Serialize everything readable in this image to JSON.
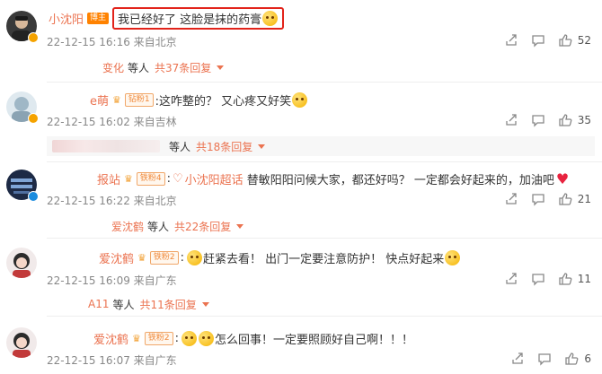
{
  "comments": [
    {
      "user": "小沈阳",
      "tag": "博主",
      "text": "我已经好了 这脸是抹的药膏",
      "time": "22-12-15 16:16 来自北京",
      "likes": "52",
      "replies": {
        "name": "变化",
        "others": "等人",
        "total": "共37条回复"
      }
    },
    {
      "user": "e萌",
      "tag": "钻粉1",
      "text": ":这咋整的？ 又心疼又好笑",
      "time": "22-12-15 16:02 来自吉林",
      "likes": "35",
      "replies": {
        "name": "",
        "others": "等人",
        "total": "共18条回复"
      }
    },
    {
      "user": "报站",
      "tag": "铁粉4",
      "mention": "小沈阳超话",
      "text": "替敏阳阳问候大家，都还好吗？ 一定都会好起来的，加油吧",
      "time": "22-12-15 16:22 来自北京",
      "likes": "21",
      "replies": {
        "name": "爱沈鹤",
        "others": "等人",
        "total": "共22条回复"
      }
    },
    {
      "user": "爱沈鹤",
      "tag": "铁粉2",
      "text": "赶紧去看！ 出门一定要注意防护！ 快点好起来",
      "time": "22-12-15 16:09 来自广东",
      "likes": "11",
      "replies": {
        "name": "A11",
        "others": "等人",
        "total": "共11条回复"
      }
    },
    {
      "user": "爱沈鹤",
      "tag": "铁粉2",
      "text": "怎么回事！一定要照顾好自己啊！！！",
      "time": "22-12-15 16:07 来自广东",
      "likes": "6"
    }
  ],
  "colors": {
    "name": "#eb7350",
    "highlight": "#e2231a",
    "reply_bg": "#f7f7f7"
  },
  "icons": [
    "share-icon",
    "comment-icon",
    "like-icon",
    "verified-badge-icon",
    "fan-heart-icon"
  ]
}
